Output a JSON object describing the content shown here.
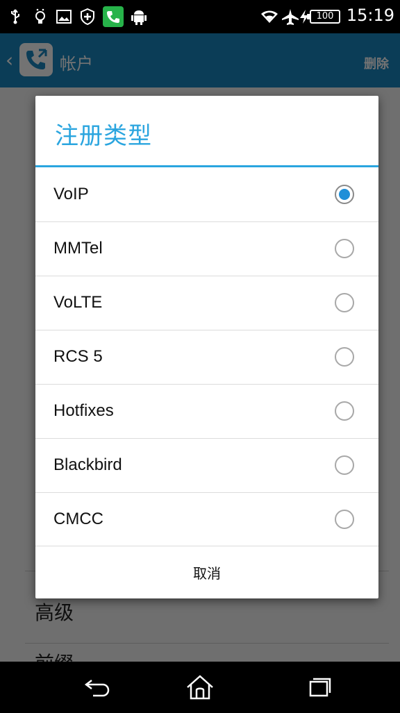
{
  "status_bar": {
    "time": "15:19",
    "battery": "100",
    "icons": [
      "usb-icon",
      "bulb-icon",
      "image-icon",
      "shield-icon",
      "phone-app-icon",
      "android-icon",
      "wifi-icon",
      "airplane-icon",
      "charging-icon"
    ]
  },
  "action_bar": {
    "title": "帐户",
    "delete_label": "删除"
  },
  "background": {
    "items": [
      "高级",
      "前缀"
    ]
  },
  "dialog": {
    "title": "注册类型",
    "options": [
      {
        "label": "VoIP",
        "checked": true
      },
      {
        "label": "MMTel",
        "checked": false
      },
      {
        "label": "VoLTE",
        "checked": false
      },
      {
        "label": "RCS 5",
        "checked": false
      },
      {
        "label": "Hotfixes",
        "checked": false
      },
      {
        "label": "Blackbird",
        "checked": false
      },
      {
        "label": "CMCC",
        "checked": false
      }
    ],
    "cancel_label": "取消"
  },
  "nav_bar": {
    "buttons": [
      "back-icon",
      "home-icon",
      "recents-icon"
    ]
  },
  "colors": {
    "accent": "#2aa5df",
    "radio_checked": "#1f8fd8",
    "action_bar": "#1a87c2"
  }
}
